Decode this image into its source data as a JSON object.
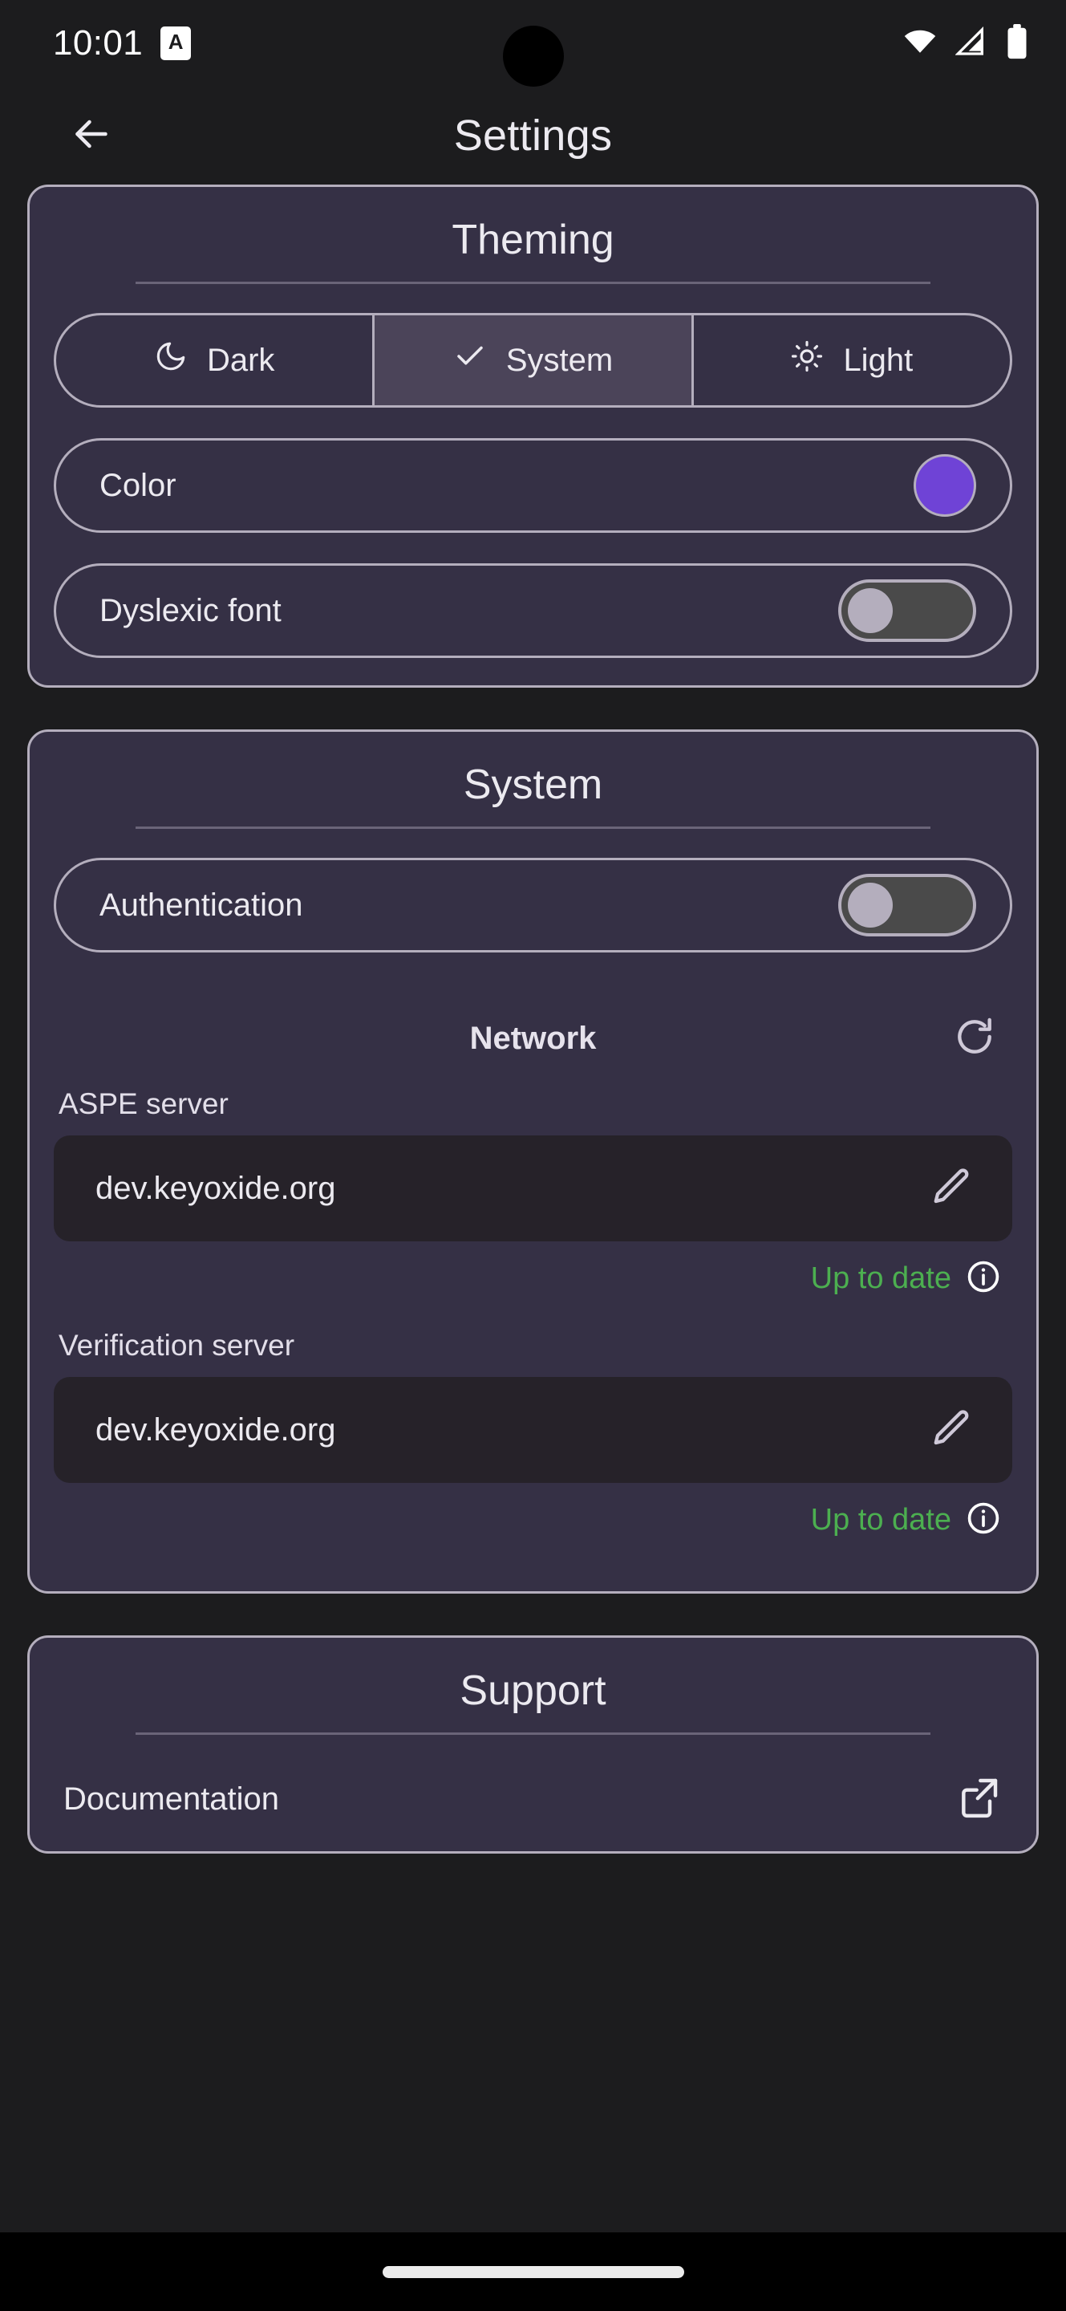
{
  "status_bar": {
    "time": "10:01",
    "badge_label": "A",
    "icons": [
      "wifi-icon",
      "cellular-signal-icon",
      "battery-icon"
    ]
  },
  "app_bar": {
    "back_icon": "arrow-left-icon",
    "title": "Settings"
  },
  "theming": {
    "title": "Theming",
    "theme_options": [
      {
        "label": "Dark",
        "icon": "moon-icon",
        "selected": false
      },
      {
        "label": "System",
        "icon": "check-icon",
        "selected": true
      },
      {
        "label": "Light",
        "icon": "sun-icon",
        "selected": false
      }
    ],
    "color_row": {
      "label": "Color",
      "swatch_hex": "#6f43d6"
    },
    "dyslexic_row": {
      "label": "Dyslexic font",
      "toggle_state": "off"
    }
  },
  "system": {
    "title": "System",
    "authentication_row": {
      "label": "Authentication",
      "toggle_state": "off"
    },
    "network": {
      "title": "Network",
      "refresh_icon": "refresh-icon",
      "fields": [
        {
          "label": "ASPE server",
          "value": "dev.keyoxide.org",
          "edit_icon": "pencil-icon",
          "status": "Up to date",
          "status_color": "#4caf50",
          "info_icon": "info-circle-icon"
        },
        {
          "label": "Verification server",
          "value": "dev.keyoxide.org",
          "edit_icon": "pencil-icon",
          "status": "Up to date",
          "status_color": "#4caf50",
          "info_icon": "info-circle-icon"
        }
      ]
    }
  },
  "support": {
    "title": "Support",
    "items": [
      {
        "label": "Documentation",
        "icon": "external-link-icon"
      }
    ]
  },
  "nav_bar": {
    "handle": "gesture-home-pill"
  }
}
